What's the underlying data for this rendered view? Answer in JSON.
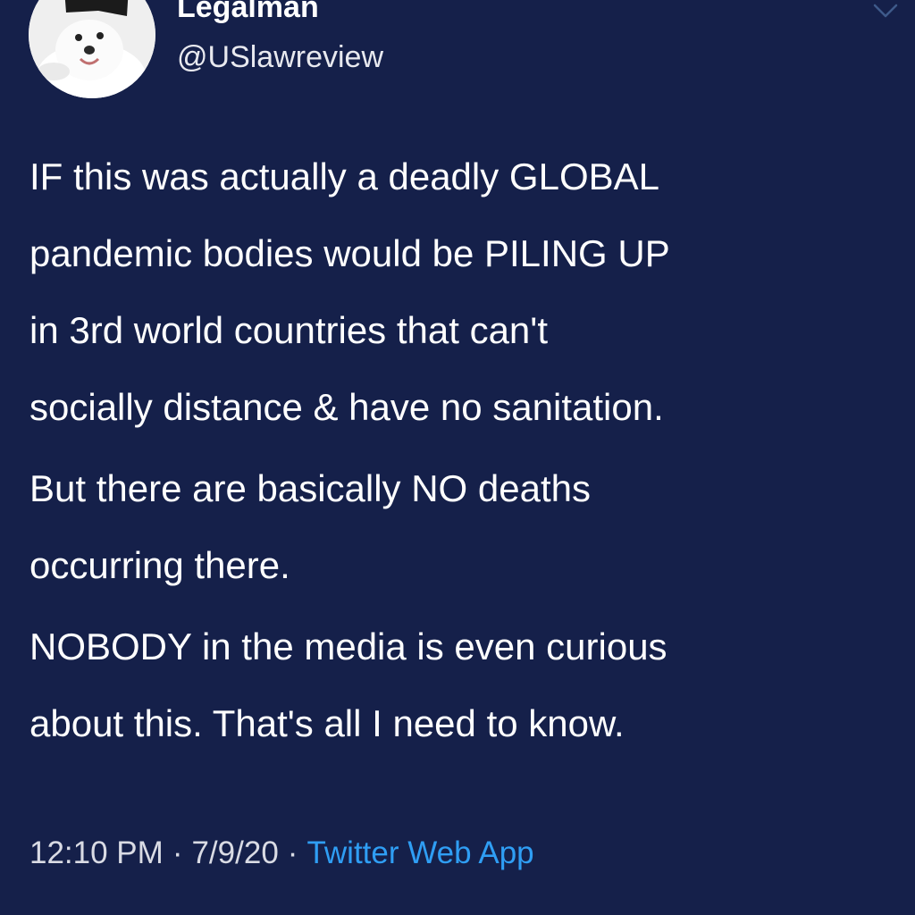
{
  "user": {
    "display_name": "Legalman",
    "handle": "@USlawreview",
    "avatar_icon": "dog-avatar"
  },
  "tweet": {
    "paragraphs": [
      {
        "lines": [
          "IF this was actually a deadly GLOBAL",
          "pandemic bodies would be PILING UP",
          "in 3rd world countries that can't",
          "socially distance & have no sanitation."
        ]
      },
      {
        "lines": [
          "But there are basically NO deaths",
          "occurring there."
        ]
      },
      {
        "lines": [
          "NOBODY in the media is even curious",
          "about this. That's all I need to know."
        ]
      }
    ],
    "time": "12:10 PM",
    "date": "7/9/20",
    "source": "Twitter Web App",
    "separator": "·"
  },
  "colors": {
    "background": "#15204a",
    "text": "#ffffff",
    "link": "#2f9ef4",
    "chevron": "#3e5a8a"
  },
  "icons": {
    "menu": "chevron-down-icon"
  }
}
